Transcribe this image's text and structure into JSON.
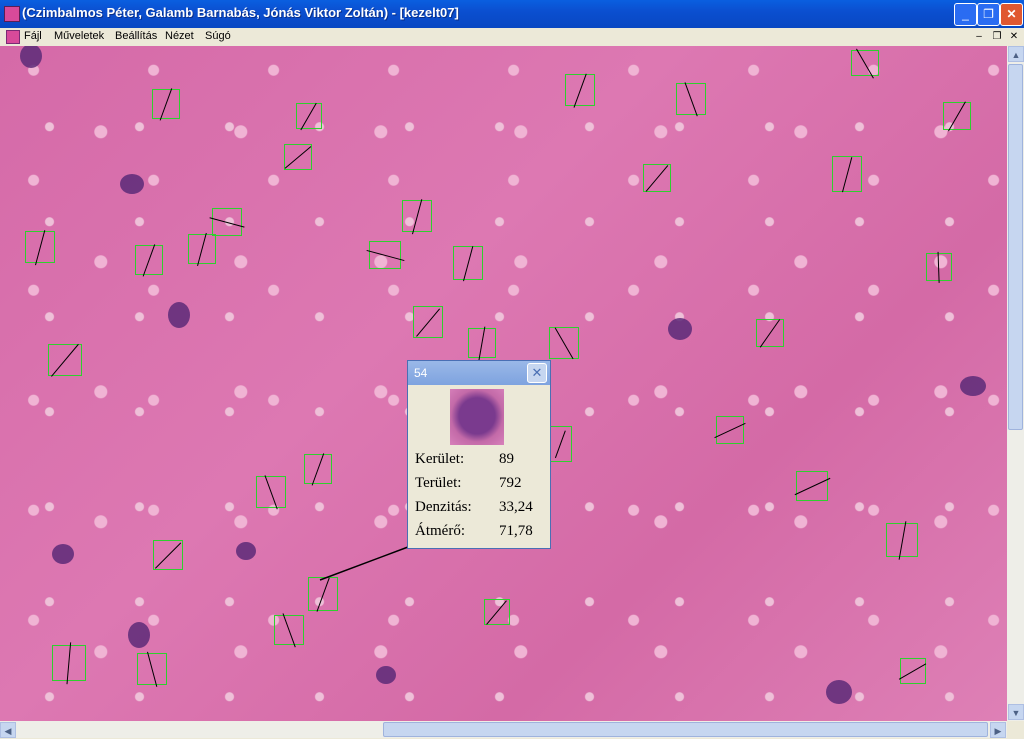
{
  "window": {
    "title": "(Czimbalmos Péter, Galamb Barnabás, Jónás Viktor Zoltán) - [kezelt07]",
    "minimize": "_",
    "maximize": "❐",
    "close": "✕"
  },
  "menu": {
    "items": [
      "Fájl",
      "Műveletek",
      "Beállítás",
      "Nézet",
      "Súgó"
    ],
    "mdi_min": "–",
    "mdi_restore": "❐",
    "mdi_close": "✕"
  },
  "popup": {
    "title": "54",
    "close": "✕",
    "stats": [
      {
        "label": "Kerület:",
        "value": "89"
      },
      {
        "label": "Terület:",
        "value": "792"
      },
      {
        "label": "Denzitás:",
        "value": "33,24"
      },
      {
        "label": "Átmérő:",
        "value": "71,78"
      }
    ]
  },
  "scrollbars": {
    "up": "▲",
    "down": "▼",
    "left": "◀",
    "right": "▶"
  }
}
